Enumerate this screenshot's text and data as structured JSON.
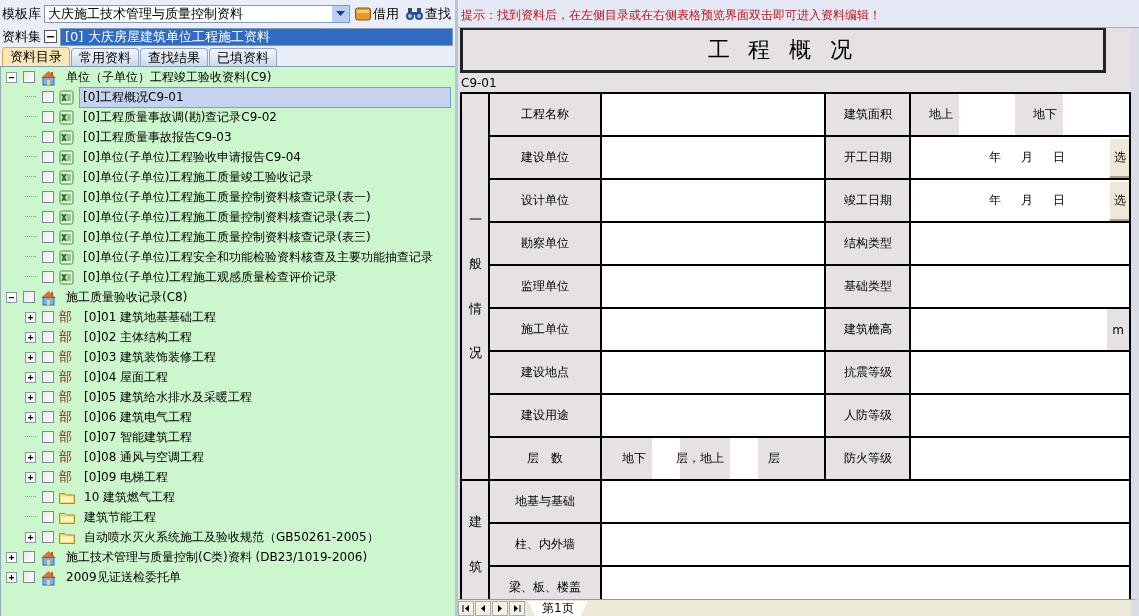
{
  "toolbar": {
    "template_label": "模板库",
    "template_value": "大庆施工技术管理与质量控制资料",
    "borrow_button": "借用",
    "find_button": "查找"
  },
  "dataset": {
    "label": "资料集",
    "value": "[0] 大庆房屋建筑单位工程施工资料"
  },
  "tabs": [
    {
      "label": "资料目录",
      "selected": true
    },
    {
      "label": "常用资料",
      "selected": false
    },
    {
      "label": "查找结果",
      "selected": false
    },
    {
      "label": "已填资料",
      "selected": false
    }
  ],
  "tree": [
    {
      "label": "单位（子单位）工程竣工验收资料(C9)",
      "kind": "root",
      "expanded": true,
      "checked": false,
      "selected": false,
      "children": [
        {
          "label": "[0]工程概况C9-01",
          "kind": "sheet",
          "checked": false,
          "selected": true
        },
        {
          "label": "[0]工程质量事故调(勘)查记录C9-02",
          "kind": "sheet",
          "checked": false,
          "selected": false
        },
        {
          "label": "[0]工程质量事故报告C9-03",
          "kind": "sheet",
          "checked": false,
          "selected": false
        },
        {
          "label": "[0]单位(子单位)工程验收申请报告C9-04",
          "kind": "sheet",
          "checked": false,
          "selected": false
        },
        {
          "label": "[0]单位(子单位)工程施工质量竣工验收记录",
          "kind": "sheet",
          "checked": false,
          "selected": false
        },
        {
          "label": "[0]单位(子单位)工程施工质量控制资料核查记录(表一)",
          "kind": "sheet",
          "checked": false,
          "selected": false
        },
        {
          "label": "[0]单位(子单位)工程施工质量控制资料核查记录(表二)",
          "kind": "sheet",
          "checked": false,
          "selected": false
        },
        {
          "label": "[0]单位(子单位)工程施工质量控制资料核查记录(表三)",
          "kind": "sheet",
          "checked": false,
          "selected": false
        },
        {
          "label": "[0]单位(子单位)工程安全和功能检验资料核查及主要功能抽查记录",
          "kind": "sheet",
          "checked": false,
          "selected": false
        },
        {
          "label": "[0]单位(子单位)工程施工观感质量检查评价记录",
          "kind": "sheet",
          "checked": false,
          "selected": false
        }
      ]
    },
    {
      "label": "施工质量验收记录(C8)",
      "kind": "root",
      "expanded": true,
      "checked": false,
      "selected": false,
      "children": [
        {
          "label": "[0]01 建筑地基基础工程",
          "kind": "part",
          "badge": "部",
          "expanded": false,
          "checked": false,
          "selected": false
        },
        {
          "label": "[0]02 主体结构工程",
          "kind": "part",
          "badge": "部",
          "expanded": false,
          "checked": false,
          "selected": false
        },
        {
          "label": "[0]03 建筑装饰装修工程",
          "kind": "part",
          "badge": "部",
          "expanded": false,
          "checked": false,
          "selected": false
        },
        {
          "label": "[0]04 屋面工程",
          "kind": "part",
          "badge": "部",
          "expanded": false,
          "checked": false,
          "selected": false
        },
        {
          "label": "[0]05 建筑给水排水及采暖工程",
          "kind": "part",
          "badge": "部",
          "expanded": false,
          "checked": false,
          "selected": false
        },
        {
          "label": "[0]06 建筑电气工程",
          "kind": "part",
          "badge": "部",
          "expanded": false,
          "checked": false,
          "selected": false
        },
        {
          "label": "[0]07 智能建筑工程",
          "kind": "part",
          "badge": "部",
          "checked": false,
          "selected": false
        },
        {
          "label": "[0]08 通风与空调工程",
          "kind": "part",
          "badge": "部",
          "expanded": false,
          "checked": false,
          "selected": false
        },
        {
          "label": "[0]09 电梯工程",
          "kind": "part",
          "badge": "部",
          "expanded": false,
          "checked": false,
          "selected": false
        },
        {
          "label": "10 建筑燃气工程",
          "kind": "folder",
          "checked": false,
          "selected": false
        },
        {
          "label": "建筑节能工程",
          "kind": "folder",
          "checked": false,
          "selected": false
        },
        {
          "label": "自动喷水灭火系统施工及验收规范（GB50261-2005）",
          "kind": "folder",
          "expanded": false,
          "checked": false,
          "selected": false
        }
      ]
    },
    {
      "label": "施工技术管理与质量控制(C类)资料 (DB23/1019-2006)",
      "kind": "root",
      "expanded": false,
      "checked": false,
      "selected": false
    },
    {
      "label": "2009见证送检委托单",
      "kind": "root",
      "expanded": false,
      "checked": false,
      "selected": false
    }
  ],
  "hint": "提示：找到资料后，在左侧目录或在右侧表格预览界面双击即可进入资料编辑！",
  "form": {
    "title": "工 程 概 况",
    "code": "C9-01",
    "sections": [
      {
        "heading": "一般情况",
        "rows": [
          {
            "label": "工程名称",
            "value": {
              "kind": "blank"
            },
            "label_2": "建筑面积",
            "value_2": {
              "kind": "area",
              "parts": [
                "地上",
                "地下"
              ]
            }
          },
          {
            "label": "建设单位",
            "value": {
              "kind": "blank"
            },
            "label_2": "开工日期",
            "value_2": {
              "kind": "date",
              "parts": [
                "年",
                "月",
                "日"
              ],
              "button": "选"
            }
          },
          {
            "label": "设计单位",
            "value": {
              "kind": "blank"
            },
            "label_2": "竣工日期",
            "value_2": {
              "kind": "date",
              "parts": [
                "年",
                "月",
                "日"
              ],
              "button": "选"
            }
          },
          {
            "label": "勘察单位",
            "value": {
              "kind": "blank"
            },
            "label_2": "结构类型",
            "value_2": {
              "kind": "blank"
            }
          },
          {
            "label": "监理单位",
            "value": {
              "kind": "blank"
            },
            "label_2": "基础类型",
            "value_2": {
              "kind": "blank"
            }
          },
          {
            "label": "施工单位",
            "value": {
              "kind": "blank"
            },
            "label_2": "建筑檐高",
            "value_2": {
              "kind": "unit",
              "unit": "m"
            }
          },
          {
            "label": "建设地点",
            "value": {
              "kind": "blank"
            },
            "label_2": "抗震等级",
            "value_2": {
              "kind": "blank"
            }
          },
          {
            "label": "建设用途",
            "value": {
              "kind": "blank"
            },
            "label_2": "人防等级",
            "value_2": {
              "kind": "blank"
            }
          },
          {
            "label": "层　数",
            "value": {
              "kind": "floors",
              "parts": [
                "地下",
                "层，地上",
                "层"
              ]
            },
            "label_2": "防火等级",
            "value_2": {
              "kind": "blank"
            }
          }
        ]
      },
      {
        "heading": "建筑",
        "rows": [
          {
            "label": "地基与基础",
            "value": {
              "kind": "blank"
            }
          },
          {
            "label": "柱、内外墙",
            "value": {
              "kind": "blank"
            }
          },
          {
            "label": "梁、板、楼盖",
            "value": {
              "kind": "blank"
            }
          }
        ]
      }
    ]
  },
  "sheets": [
    {
      "label": "第1页",
      "selected": true
    }
  ]
}
